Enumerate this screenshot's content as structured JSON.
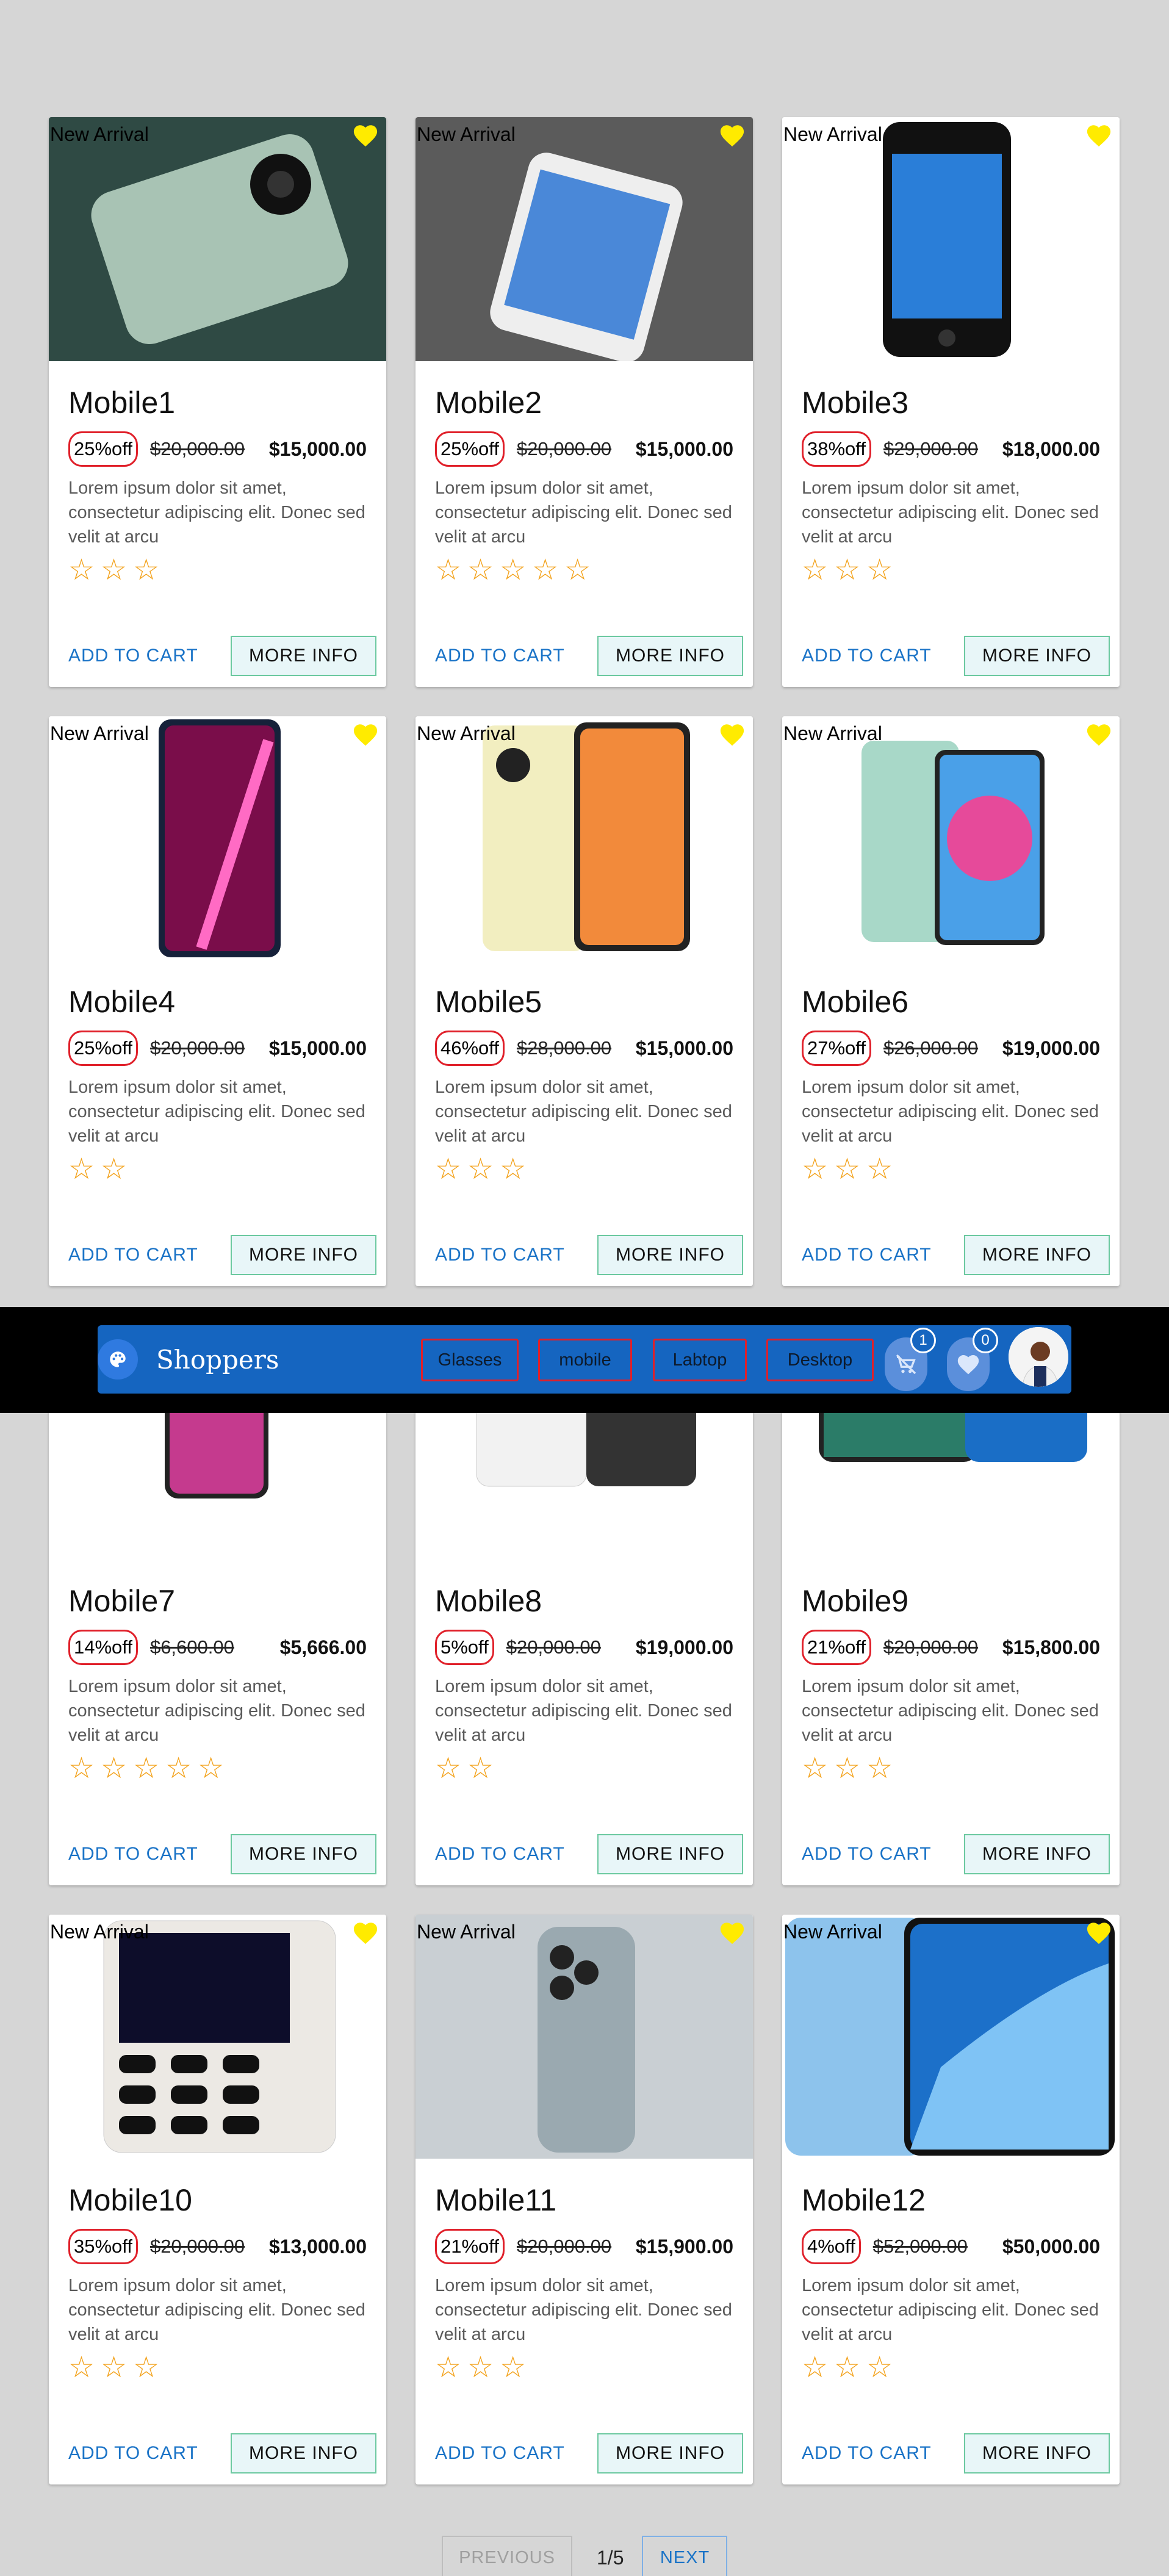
{
  "app": {
    "brand": "Shoppers"
  },
  "nav": {
    "categories": [
      "Glasses",
      "mobile",
      "Labtop",
      "Desktop"
    ],
    "cart_count": "1",
    "wishlist_count": "0"
  },
  "labels": {
    "badge": "New Arrival",
    "add_to_cart": "ADD TO CART",
    "more_info": "MORE INFO",
    "star": "☆"
  },
  "products": [
    {
      "name": "Mobile1",
      "discount": "25%off",
      "old_price": "$20,000.00",
      "price": "$15,000.00",
      "desc": "Lorem ipsum dolor sit amet, consectetur adipiscing elit. Donec sed velit at arcu",
      "rating": 3
    },
    {
      "name": "Mobile2",
      "discount": "25%off",
      "old_price": "$20,000.00",
      "price": "$15,000.00",
      "desc": "Lorem ipsum dolor sit amet, consectetur adipiscing elit. Donec sed velit at arcu",
      "rating": 5
    },
    {
      "name": "Mobile3",
      "discount": "38%off",
      "old_price": "$29,000.00",
      "price": "$18,000.00",
      "desc": "Lorem ipsum dolor sit amet, consectetur adipiscing elit. Donec sed velit at arcu",
      "rating": 3
    },
    {
      "name": "Mobile4",
      "discount": "25%off",
      "old_price": "$20,000.00",
      "price": "$15,000.00",
      "desc": "Lorem ipsum dolor sit amet, consectetur adipiscing elit. Donec sed velit at arcu",
      "rating": 2
    },
    {
      "name": "Mobile5",
      "discount": "46%off",
      "old_price": "$28,000.00",
      "price": "$15,000.00",
      "desc": "Lorem ipsum dolor sit amet, consectetur adipiscing elit. Donec sed velit at arcu",
      "rating": 3
    },
    {
      "name": "Mobile6",
      "discount": "27%off",
      "old_price": "$26,000.00",
      "price": "$19,000.00",
      "desc": "Lorem ipsum dolor sit amet, consectetur adipiscing elit. Donec sed velit at arcu",
      "rating": 3
    },
    {
      "name": "Mobile7",
      "discount": "14%off",
      "old_price": "$6,600.00",
      "price": "$5,666.00",
      "desc": "Lorem ipsum dolor sit amet, consectetur adipiscing elit. Donec sed velit at arcu",
      "rating": 5
    },
    {
      "name": "Mobile8",
      "discount": "5%off",
      "old_price": "$20,000.00",
      "price": "$19,000.00",
      "desc": "Lorem ipsum dolor sit amet, consectetur adipiscing elit. Donec sed velit at arcu",
      "rating": 2
    },
    {
      "name": "Mobile9",
      "discount": "21%off",
      "old_price": "$20,000.00",
      "price": "$15,800.00",
      "desc": "Lorem ipsum dolor sit amet, consectetur adipiscing elit. Donec sed velit at arcu",
      "rating": 3
    },
    {
      "name": "Mobile10",
      "discount": "35%off",
      "old_price": "$20,000.00",
      "price": "$13,000.00",
      "desc": "Lorem ipsum dolor sit amet, consectetur adipiscing elit. Donec sed velit at arcu",
      "rating": 3
    },
    {
      "name": "Mobile11",
      "discount": "21%off",
      "old_price": "$20,000.00",
      "price": "$15,900.00",
      "desc": "Lorem ipsum dolor sit amet, consectetur adipiscing elit. Donec sed velit at arcu",
      "rating": 3
    },
    {
      "name": "Mobile12",
      "discount": "4%off",
      "old_price": "$52,000.00",
      "price": "$50,000.00",
      "desc": "Lorem ipsum dolor sit amet, consectetur adipiscing elit. Donec sed velit at arcu",
      "rating": 3
    }
  ],
  "pagination": {
    "prev": "PREVIOUS",
    "page": "1/5",
    "next": "NEXT"
  },
  "colors": {
    "heart": "#ffeb00",
    "nav": "#1565c0",
    "star": "#f3a21b",
    "discount_border": "#e0202a"
  }
}
